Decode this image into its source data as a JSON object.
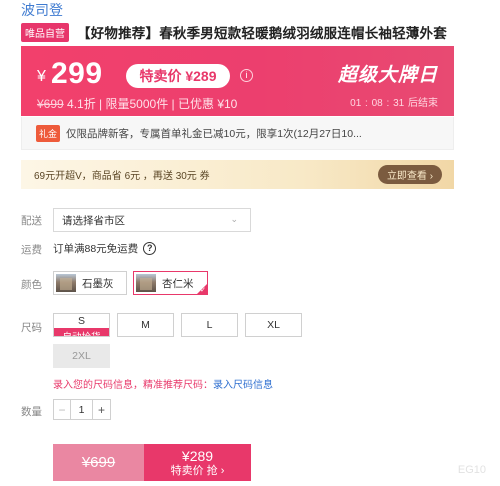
{
  "header": {
    "brand": "波司登",
    "vip_tag": "唯品自营",
    "title": "【好物推荐】春秋季男短款轻暖鹅绒羽绒服连帽长袖轻薄外套"
  },
  "promo": {
    "price_symbol": "¥",
    "price": "299",
    "sale_pill": "特卖价 ¥289",
    "info_icon": "i",
    "original_price": "¥699",
    "sub_rest": " 4.1折 | 限量5000件 | 已优惠 ¥10",
    "headline": "超级大牌日",
    "countdown": {
      "h": "01",
      "m": "08",
      "s": "31",
      "suffix": "后结束"
    },
    "colors": {
      "background": "#ec3f6e",
      "accent": "#e8386a"
    }
  },
  "gift": {
    "tag": "礼金",
    "text": "仅限品牌新客，专属首单礼金已减10元，限享1次(12月27日10..."
  },
  "vip_bar": {
    "text": "69元开超V，商品省 6元 ，再送 30元 券",
    "button": "立即查看 ›"
  },
  "labels": {
    "delivery": "配送",
    "freight": "运费",
    "color": "颜色",
    "size": "尺码",
    "quantity": "数量"
  },
  "delivery": {
    "placeholder": "请选择省市区",
    "caret": "⌄"
  },
  "freight": {
    "text": "订单满88元免运费",
    "help_icon": "?"
  },
  "colors": [
    {
      "label": "石墨灰",
      "selected": false
    },
    {
      "label": "杏仁米",
      "selected": true
    }
  ],
  "sizes": [
    {
      "label": "S",
      "badge": "自动抢货",
      "disabled": false
    },
    {
      "label": "M",
      "disabled": false
    },
    {
      "label": "L",
      "disabled": false
    },
    {
      "label": "XL",
      "disabled": false
    },
    {
      "label": "2XL",
      "disabled": true
    }
  ],
  "size_link": {
    "text": "录入您的尺码信息，精准推荐尺码：",
    "action": "录入尺码信息"
  },
  "quantity": {
    "minus": "−",
    "value": "1",
    "plus": "+"
  },
  "buy": {
    "left_price": "¥699",
    "right_price": "¥289",
    "right_label": "特卖价 抢 ›"
  },
  "watermark": "EG10"
}
